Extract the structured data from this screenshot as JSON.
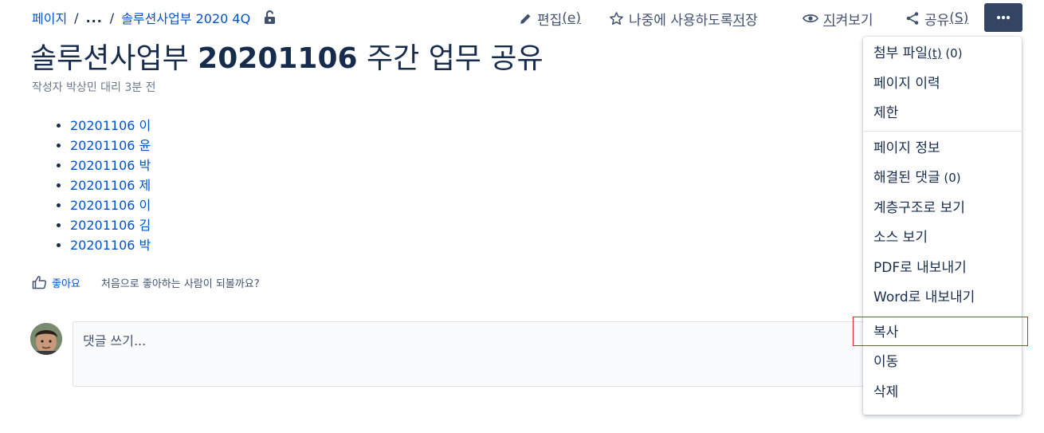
{
  "breadcrumb": {
    "root": "페이지",
    "ellipsis": "...",
    "separator": "/",
    "parent": "솔루션사업부 2020 4Q"
  },
  "actions": {
    "edit": {
      "label": "편집",
      "key": "(e)"
    },
    "save_for_later": {
      "label": "나중에 사용하도록 ",
      "key_char": "저",
      "after": "장"
    },
    "watch": {
      "label_key": "지",
      "label_rest": "켜보기"
    },
    "share": {
      "label": "공유",
      "key": "(S)"
    },
    "more": "···"
  },
  "page": {
    "title_prefix": "솔루션사업부 ",
    "title_number": "20201106",
    "title_suffix": " 주간 업무 공유",
    "byline": "작성자 박상민 대리 3분 전"
  },
  "children": [
    "20201106 이",
    "20201106 윤",
    "20201106 박",
    "20201106 제",
    "20201106 이",
    "20201106 김",
    "20201106 박"
  ],
  "like": {
    "label": "좋아요",
    "hint": "처음으로 좋아하는 사람이 되볼까요?"
  },
  "comment": {
    "placeholder": "댓글 쓰기..."
  },
  "menu": {
    "attachments": {
      "label": "첨부 파일",
      "key": "(t)",
      "count": " (0)"
    },
    "history": "페이지 이력",
    "restrictions": "제한",
    "page_info": "페이지 정보",
    "resolved_comments": {
      "label": "해결된 댓글",
      "count": " (0)"
    },
    "hierarchy": "계층구조로 보기",
    "view_source": "소스 보기",
    "export_pdf": "PDF로 내보내기",
    "export_word": "Word로 내보내기",
    "copy": "복사",
    "move": "이동",
    "delete": "삭제"
  },
  "colors": {
    "link": "#0052cc",
    "text": "#172b4d",
    "more_button_bg": "#344563",
    "highlight": "#e5252a"
  }
}
